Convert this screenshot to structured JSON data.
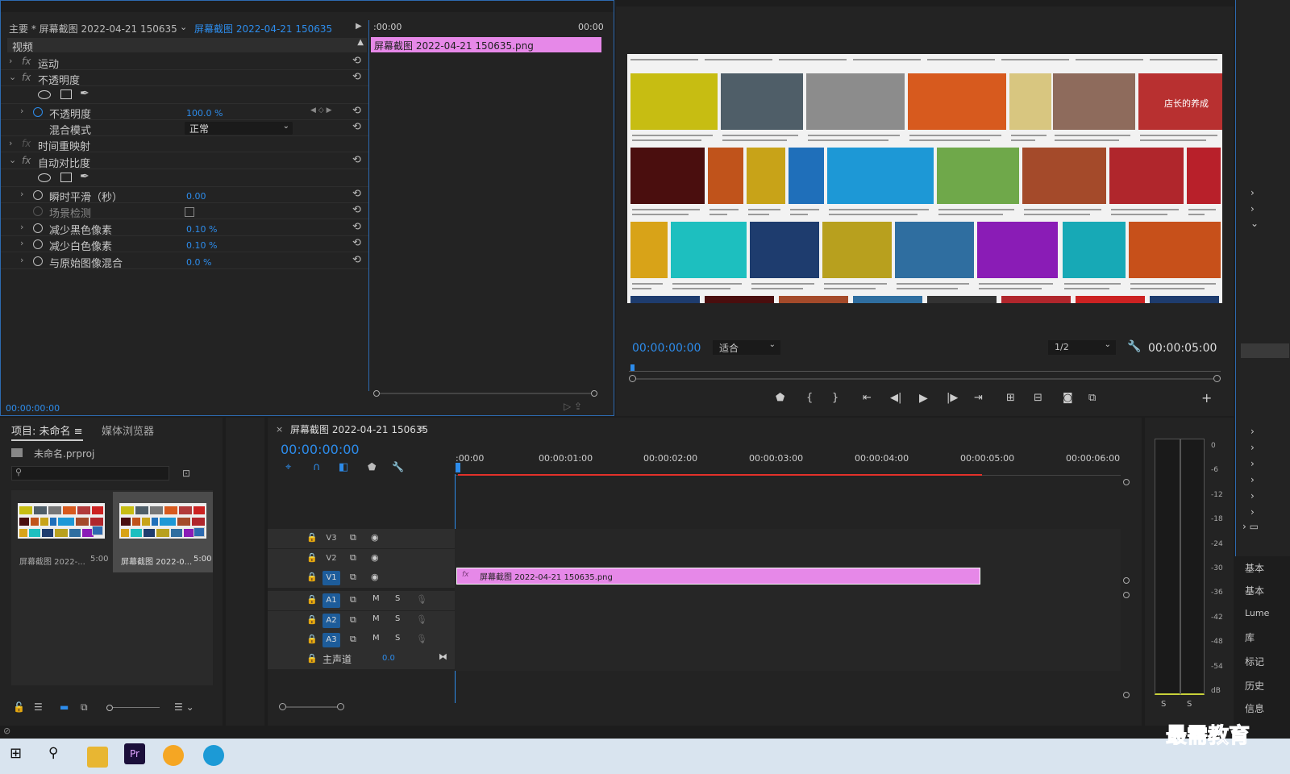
{
  "effect_controls": {
    "master_label": "主要 * 屏幕截图 2022-04-21 150635...",
    "clip_label": "屏幕截图 2022-04-21 150635 * ...",
    "time_start": ":00:00",
    "time_end": "00:00",
    "clip_name": "屏幕截图 2022-04-21  150635.png",
    "section": "视频",
    "rows": [
      {
        "label": "运动",
        "fx": "fx"
      },
      {
        "label": "不透明度",
        "fx": "fx"
      },
      {
        "label": "不透明度",
        "value": "100.0 %"
      },
      {
        "label": "混合模式",
        "value": "正常"
      },
      {
        "label": "时间重映射",
        "fx": "fx"
      },
      {
        "label": "自动对比度",
        "fx": "fx"
      },
      {
        "label": "瞬时平滑（秒）",
        "value": "0.00"
      },
      {
        "label": "场景检测"
      },
      {
        "label": "减少黑色像素",
        "value": "0.10 %"
      },
      {
        "label": "减少白色像素",
        "value": "0.10 %"
      },
      {
        "label": "与原始图像混合",
        "value": "0.0 %"
      }
    ],
    "footer_time": "00:00:00:00"
  },
  "program_monitor": {
    "timecode": "00:00:00:00",
    "fit_label": "适合",
    "resolution": "1/2",
    "duration": "00:00:05:00",
    "overlay_text": "店长的养成"
  },
  "project_panel": {
    "tab_project": "项目: 未命名",
    "tab_media": "媒体浏览器",
    "filename": "未命名.prproj",
    "items": [
      {
        "name": "屏幕截图 2022-...",
        "duration": "5:00"
      },
      {
        "name": "屏幕截图 2022-0...",
        "duration": "5:00"
      }
    ]
  },
  "timeline": {
    "tab_title": "屏幕截图 2022-04-21 150635",
    "timecode": "00:00:00:00",
    "ruler": [
      ":00:00",
      "00:00:01:00",
      "00:00:02:00",
      "00:00:03:00",
      "00:00:04:00",
      "00:00:05:00",
      "00:00:06:00"
    ],
    "video_tracks": [
      "V3",
      "V2",
      "V1"
    ],
    "audio_tracks": [
      "A1",
      "A2",
      "A3"
    ],
    "master_label": "主声道",
    "master_value": "0.0",
    "clip_name": "屏幕截图 2022-04-21  150635.png",
    "m": "M",
    "s": "S"
  },
  "audio_meter": {
    "scale": [
      "0",
      "-6",
      "-12",
      "-18",
      "-24",
      "-30",
      "-36",
      "-42",
      "-48",
      "-54",
      "dB"
    ],
    "solo": "S"
  },
  "right_panels": [
    "基本",
    "基本",
    "Lume",
    "库",
    "标记",
    "历史",
    "信息"
  ],
  "watermark": "最需教育",
  "colors": {
    "accent": "#2d8ceb",
    "clip": "#e688e8",
    "playhead_bar": "#e2312a"
  }
}
